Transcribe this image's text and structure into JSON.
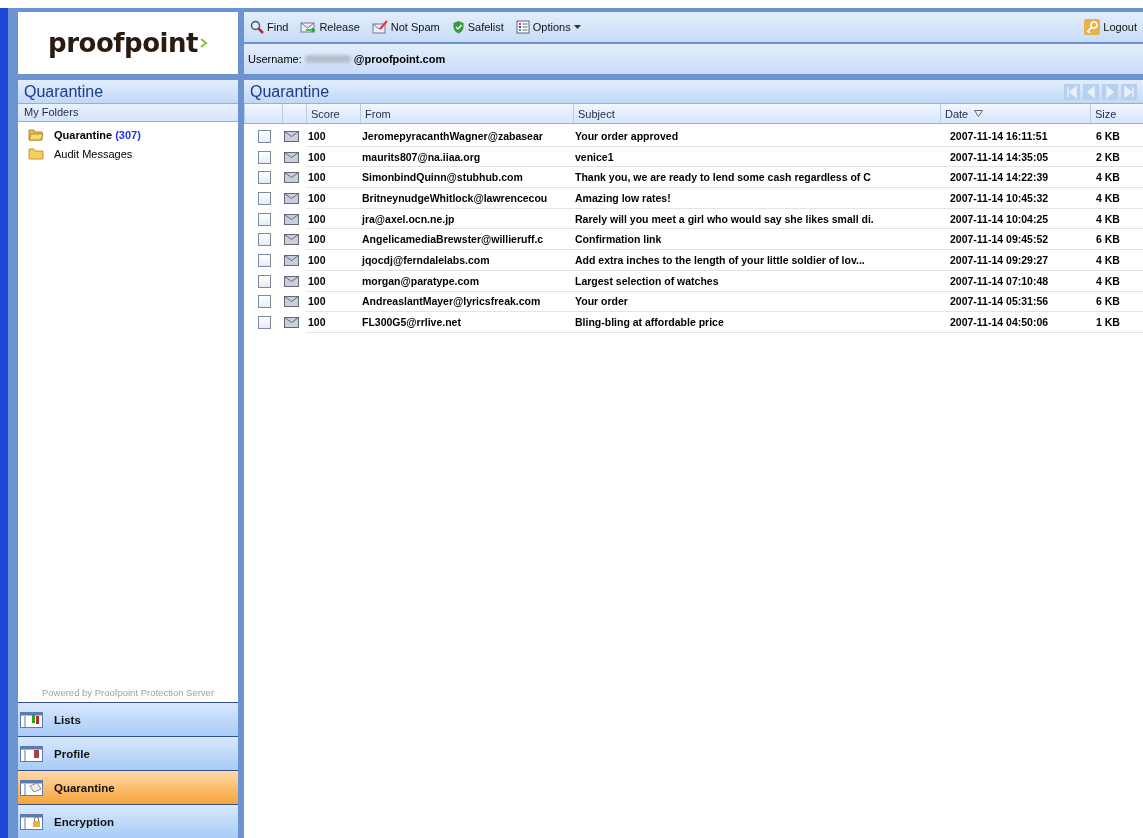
{
  "logo": {
    "text": "proofpoint"
  },
  "toolbar": {
    "buttons": [
      {
        "kind": "find",
        "label": "Find"
      },
      {
        "kind": "release",
        "label": "Release"
      },
      {
        "kind": "notspam",
        "label": "Not Spam"
      },
      {
        "kind": "safelist",
        "label": "Safelist"
      },
      {
        "kind": "options",
        "label": "Options"
      }
    ],
    "logout": "Logout"
  },
  "user": {
    "label": "Username:",
    "domain": "@proofpoint.com"
  },
  "sidebar": {
    "title": "Quarantine",
    "section": "My Folders",
    "folders": [
      {
        "label": "Quarantine",
        "count": "(307)",
        "selected": true,
        "open": true
      },
      {
        "label": "Audit Messages",
        "selected": false,
        "open": false
      }
    ],
    "powered_by": "Powered by Proofpoint Protection Server",
    "nav": [
      {
        "kind": "lists",
        "label": "Lists",
        "selected": false
      },
      {
        "kind": "profile",
        "label": "Profile",
        "selected": false
      },
      {
        "kind": "quarantine",
        "label": "Quarantine",
        "selected": true
      },
      {
        "kind": "encryption",
        "label": "Encryption",
        "selected": false
      }
    ]
  },
  "main": {
    "title": "Quarantine",
    "columns": [
      {
        "label": "Score",
        "sorted": false
      },
      {
        "label": "From",
        "sorted": false
      },
      {
        "label": "Subject",
        "sorted": false
      },
      {
        "label": "Date",
        "sorted": true
      },
      {
        "label": "Size",
        "sorted": false
      }
    ],
    "rows": [
      {
        "checked": false,
        "score": "100",
        "from": "JeromepyracanthWagner@zabasear",
        "subject": "Your order approved",
        "date": "2007-11-14 16:11:51",
        "size": "6 KB"
      },
      {
        "checked": false,
        "score": "100",
        "from": "maurits807@na.iiaa.org",
        "subject": "venice1",
        "date": "2007-11-14 14:35:05",
        "size": "2 KB"
      },
      {
        "checked": false,
        "score": "100",
        "from": "SimonbindQuinn@stubhub.com",
        "subject": "Thank you, we are ready to lend some cash regardless of C",
        "date": "2007-11-14 14:22:39",
        "size": "4 KB"
      },
      {
        "checked": false,
        "score": "100",
        "from": "BritneynudgeWhitlock@lawrencecou",
        "subject": "Amazing low rates!",
        "date": "2007-11-14 10:45:32",
        "size": "4 KB"
      },
      {
        "checked": false,
        "score": "100",
        "from": "jra@axel.ocn.ne.jp",
        "subject": "Rarely will you meet a girl who would say she likes small di.",
        "date": "2007-11-14 10:04:25",
        "size": "4 KB"
      },
      {
        "checked": false,
        "score": "100",
        "from": "AngelicamediaBrewster@willieruff.c",
        "subject": "Confirmation link",
        "date": "2007-11-14 09:45:52",
        "size": "6 KB"
      },
      {
        "checked": false,
        "score": "100",
        "from": "jqocdj@ferndalelabs.com",
        "subject": "Add extra inches to the length of your little soldier of lov...",
        "date": "2007-11-14 09:29:27",
        "size": "4 KB"
      },
      {
        "checked": false,
        "score": "100",
        "from": "morgan@paratype.com",
        "subject": "Largest selection of watches",
        "date": "2007-11-14 07:10:48",
        "size": "4 KB"
      },
      {
        "checked": false,
        "score": "100",
        "from": "AndreaslantMayer@lyricsfreak.com",
        "subject": "Your order",
        "date": "2007-11-14 05:31:56",
        "size": "6 KB"
      },
      {
        "checked": false,
        "score": "100",
        "from": "FL300G5@rrlive.net",
        "subject": "Bling-bling at affordable price",
        "date": "2007-11-14 04:50:06",
        "size": "1 KB"
      }
    ]
  }
}
